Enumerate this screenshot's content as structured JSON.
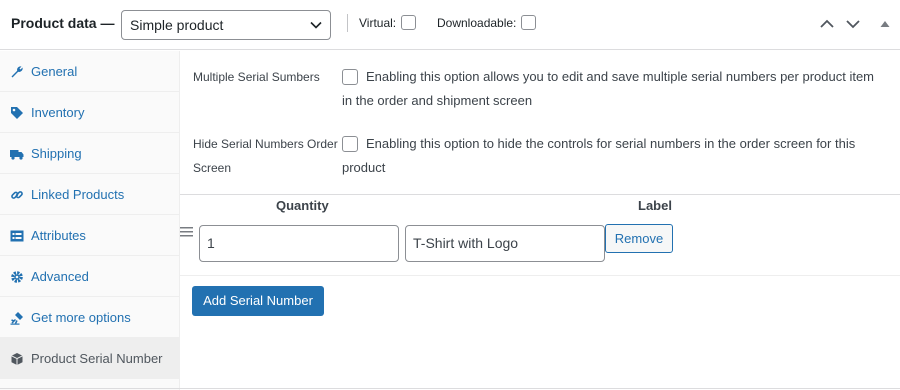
{
  "header": {
    "title": "Product data —",
    "product_type": "Simple product",
    "virtual_label": "Virtual:",
    "downloadable_label": "Downloadable:",
    "icons": [
      "chevron-up-icon",
      "chevron-down-icon",
      "collapse-triangle-icon"
    ]
  },
  "sidebar": {
    "items": [
      {
        "label": "General",
        "icon": "wrench-icon"
      },
      {
        "label": "Inventory",
        "icon": "tag-icon"
      },
      {
        "label": "Shipping",
        "icon": "truck-icon"
      },
      {
        "label": "Linked Products",
        "icon": "link-icon"
      },
      {
        "label": "Attributes",
        "icon": "list-icon"
      },
      {
        "label": "Advanced",
        "icon": "gear-icon"
      },
      {
        "label": "Get more options",
        "icon": "plugin-icon"
      },
      {
        "label": "Product Serial Number",
        "icon": "box-icon",
        "active": true
      }
    ]
  },
  "options": {
    "multiple": {
      "label_line1": "Multiple Serial Sumbers",
      "desc_line1": "Enabling this option allows you to edit and save multiple serial numbers per product item",
      "desc_line2": "in the order and shipment screen",
      "checked": false
    },
    "hide": {
      "label_line1": "Hide Serial Numbers Order",
      "label_line2": "Screen",
      "desc_line1": "Enabling this option to hide the controls for serial numbers in the order screen for this",
      "desc_line2": "product",
      "checked": false
    }
  },
  "table": {
    "headers": {
      "quantity": "Quantity",
      "label": "Label"
    },
    "rows": [
      {
        "quantity": "1",
        "label": "T-Shirt with Logo",
        "remove": "Remove"
      }
    ]
  },
  "add_button": "Add Serial Number",
  "colors": {
    "accent": "#2271b1",
    "text": "#1d2327",
    "muted": "#3c434a",
    "border": "#8c8f94"
  }
}
